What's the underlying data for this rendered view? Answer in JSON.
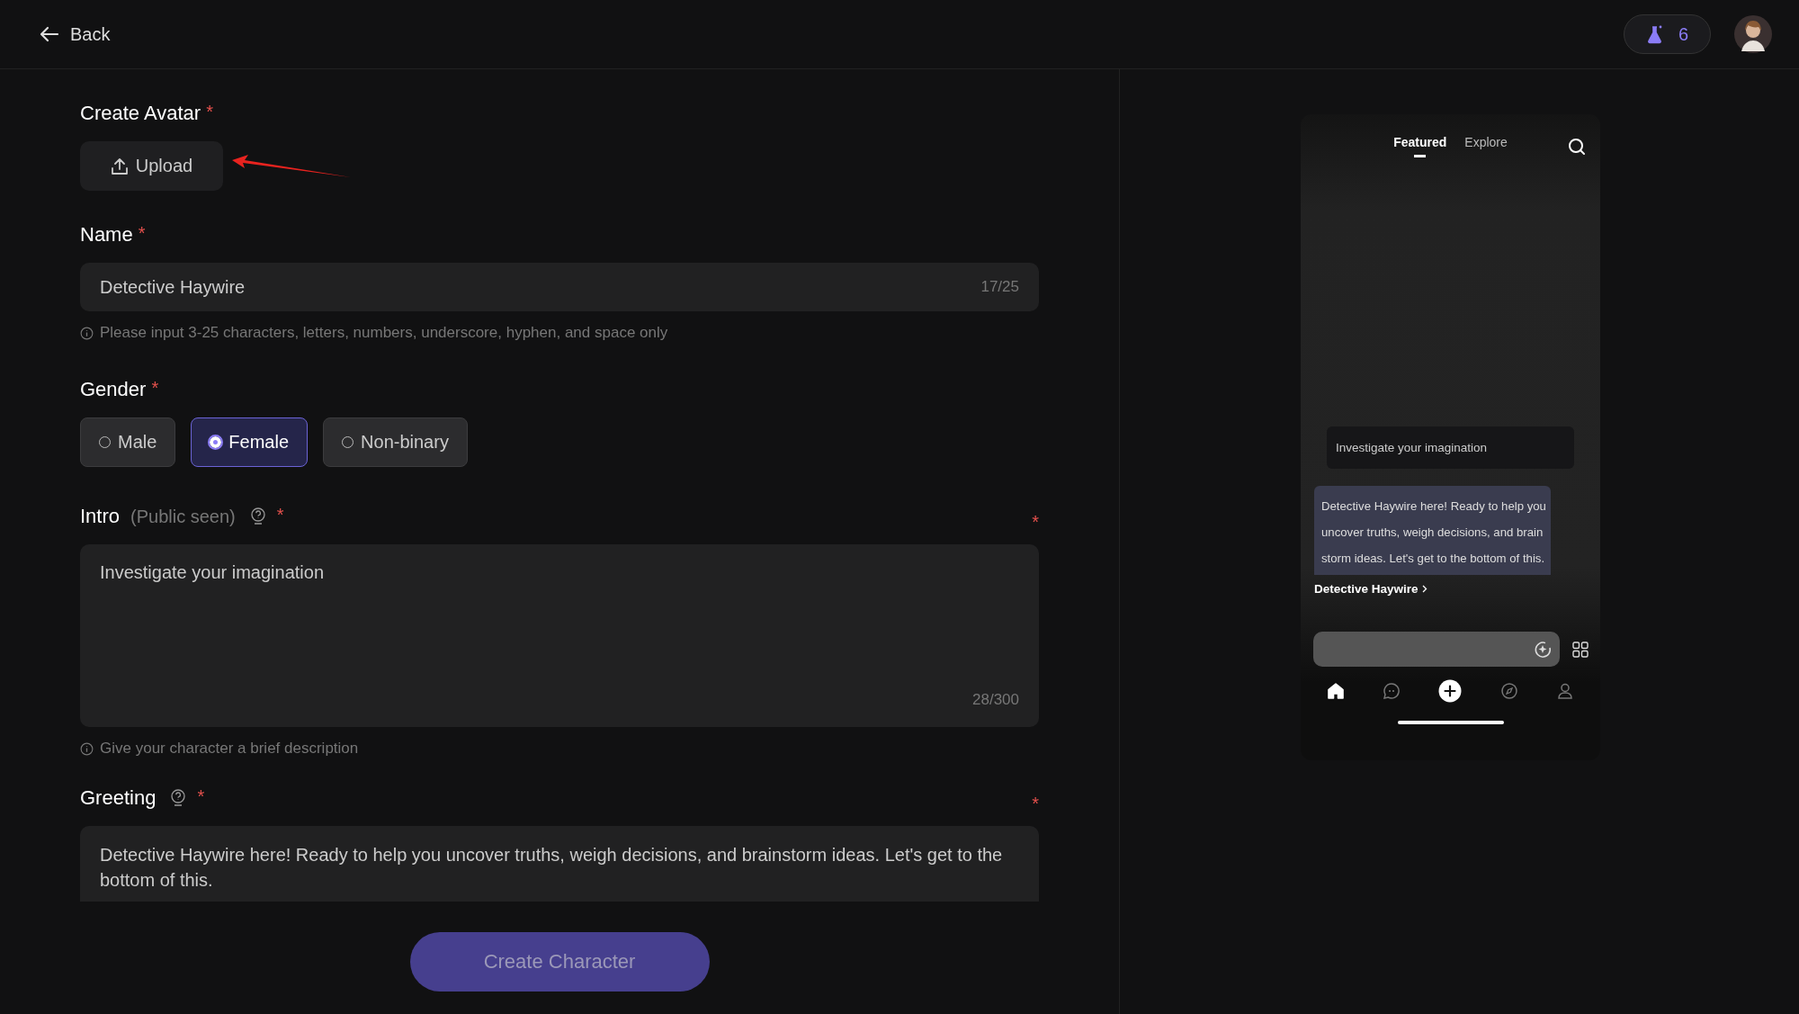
{
  "header": {
    "back_label": "Back",
    "credits": "6"
  },
  "avatar_section": {
    "label": "Create Avatar",
    "required_mark": "*",
    "upload_label": "Upload"
  },
  "name_field": {
    "label": "Name",
    "required_mark": "*",
    "value": "Detective Haywire",
    "counter": "17/25",
    "hint": "Please input 3-25 characters, letters, numbers, underscore, hyphen, and space only"
  },
  "gender": {
    "label": "Gender",
    "required_mark": "*",
    "options": [
      {
        "label": "Male",
        "selected": false
      },
      {
        "label": "Female",
        "selected": true
      },
      {
        "label": "Non-binary",
        "selected": false
      }
    ]
  },
  "intro": {
    "label": "Intro",
    "note": "(Public seen)",
    "help": true,
    "required_mark": "*",
    "side_mark": "*",
    "value": "Investigate your imagination",
    "counter": "28/300",
    "hint": "Give your character a brief description"
  },
  "greeting": {
    "label": "Greeting",
    "help": true,
    "required_mark": "*",
    "side_mark": "*",
    "value": "Detective Haywire here! Ready to help you uncover truths, weigh decisions, and brainstorm ideas. Let's get to the bottom of this."
  },
  "submit_label": "Create Character",
  "preview": {
    "tabs": [
      {
        "label": "Featured",
        "selected": true
      },
      {
        "label": "Explore",
        "selected": false
      }
    ],
    "user_message": "Investigate your imagination",
    "bot_message": "Detective Haywire here! Ready to help you uncover truths, weigh decisions, and brainstorm ideas. Let's get to the bottom of this.",
    "character_name": "Detective Haywire",
    "nav": [
      {
        "kind": "home",
        "selected": true
      },
      {
        "kind": "chat",
        "selected": false
      },
      {
        "kind": "create",
        "selected": false
      },
      {
        "kind": "explore",
        "selected": false
      },
      {
        "kind": "profile",
        "selected": false
      }
    ]
  }
}
